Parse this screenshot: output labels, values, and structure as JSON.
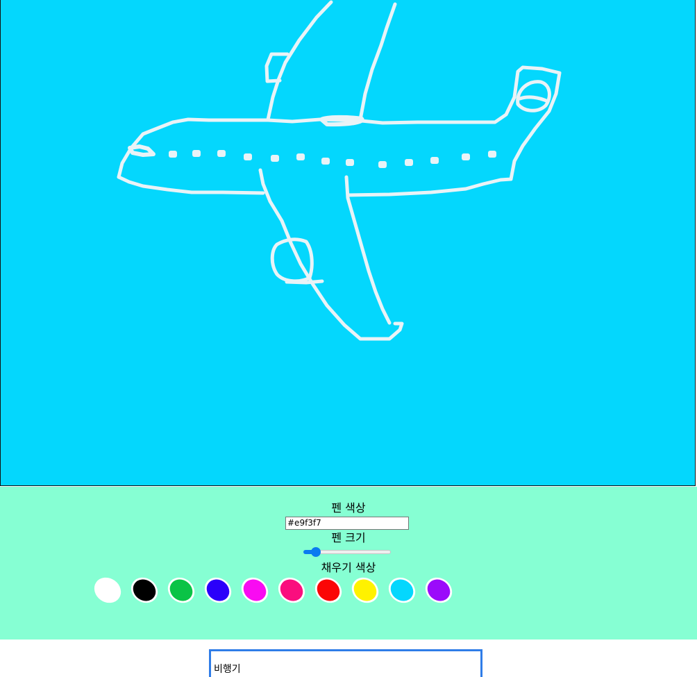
{
  "canvas": {
    "background_color": "#04d7fd",
    "drawing_stroke_color": "#e9f3f7"
  },
  "controls": {
    "background_color": "#86ffd3",
    "pen_color_label": "펜 색상",
    "pen_color_value": "#e9f3f7",
    "pen_size_label": "펜 크기",
    "pen_size_level": 0.1,
    "fill_color_label": "채우기 색상",
    "fill_colors": [
      {
        "name": "white",
        "hex": "#ffffff"
      },
      {
        "name": "black",
        "hex": "#000000"
      },
      {
        "name": "green",
        "hex": "#0ac346"
      },
      {
        "name": "blue",
        "hex": "#2b00fa"
      },
      {
        "name": "magenta",
        "hex": "#f90bf2"
      },
      {
        "name": "pink",
        "hex": "#fa0e7e"
      },
      {
        "name": "red",
        "hex": "#fb0606"
      },
      {
        "name": "yellow",
        "hex": "#fff200"
      },
      {
        "name": "sky-blue",
        "hex": "#04d7fd"
      },
      {
        "name": "purple",
        "hex": "#9b0bfa"
      }
    ]
  },
  "answer_input": {
    "value": "비행기"
  }
}
